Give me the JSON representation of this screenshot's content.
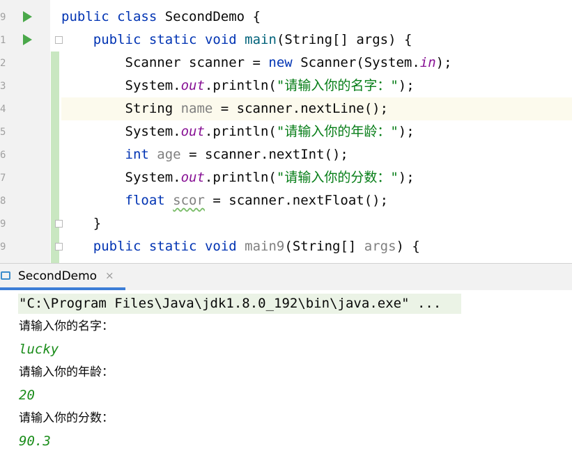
{
  "editor": {
    "line_numbers": [
      "9",
      "1",
      "2",
      "3",
      "4",
      "5",
      "6",
      "7",
      "8",
      "9",
      "9"
    ],
    "lines": [
      {
        "segs": [
          {
            "t": "public",
            "c": "kw"
          },
          {
            "t": " "
          },
          {
            "t": "class",
            "c": "kw"
          },
          {
            "t": " SecondDemo {"
          }
        ]
      },
      {
        "segs": [
          {
            "t": "    "
          },
          {
            "t": "public",
            "c": "kw"
          },
          {
            "t": " "
          },
          {
            "t": "static",
            "c": "kw"
          },
          {
            "t": " "
          },
          {
            "t": "void",
            "c": "kw"
          },
          {
            "t": " "
          },
          {
            "t": "main",
            "c": "fn"
          },
          {
            "t": "(String[] args) {"
          }
        ]
      },
      {
        "segs": [
          {
            "t": "        Scanner scanner = "
          },
          {
            "t": "new",
            "c": "kw"
          },
          {
            "t": " Scanner(System."
          },
          {
            "t": "in",
            "c": "fld"
          },
          {
            "t": ");"
          }
        ]
      },
      {
        "segs": [
          {
            "t": "        System."
          },
          {
            "t": "out",
            "c": "fld"
          },
          {
            "t": ".println("
          },
          {
            "t": "\"请输入你的名字：\"",
            "c": "str"
          },
          {
            "t": ");"
          }
        ]
      },
      {
        "segs": [
          {
            "t": "        String "
          },
          {
            "t": "name",
            "c": "unused"
          },
          {
            "t": " = scanner.nextLine();"
          }
        ]
      },
      {
        "segs": [
          {
            "t": "        System."
          },
          {
            "t": "out",
            "c": "fld"
          },
          {
            "t": ".println("
          },
          {
            "t": "\"请输入你的年龄：\"",
            "c": "str"
          },
          {
            "t": ");"
          }
        ]
      },
      {
        "segs": [
          {
            "t": "        "
          },
          {
            "t": "int",
            "c": "kw"
          },
          {
            "t": " "
          },
          {
            "t": "age",
            "c": "unused"
          },
          {
            "t": " = scanner.nextInt();"
          }
        ]
      },
      {
        "segs": [
          {
            "t": "        System."
          },
          {
            "t": "out",
            "c": "fld"
          },
          {
            "t": ".println("
          },
          {
            "t": "\"请输入你的分数：\"",
            "c": "str"
          },
          {
            "t": ");"
          }
        ]
      },
      {
        "segs": [
          {
            "t": "        "
          },
          {
            "t": "float",
            "c": "kw"
          },
          {
            "t": " "
          },
          {
            "t": "scor",
            "c": "warn"
          },
          {
            "t": " = scanner.nextFloat();"
          }
        ]
      },
      {
        "segs": [
          {
            "t": "    }"
          }
        ]
      },
      {
        "segs": [
          {
            "t": "    "
          },
          {
            "t": "public",
            "c": "kw"
          },
          {
            "t": " "
          },
          {
            "t": "static",
            "c": "kw"
          },
          {
            "t": " "
          },
          {
            "t": "void",
            "c": "kw"
          },
          {
            "t": " "
          },
          {
            "t": "main9",
            "c": "unused"
          },
          {
            "t": "(String[] "
          },
          {
            "t": "args",
            "c": "unused"
          },
          {
            "t": ") {"
          }
        ]
      }
    ]
  },
  "run_window": {
    "tab_label": "SecondDemo",
    "tab_close": "×"
  },
  "console": {
    "command": "\"C:\\Program Files\\Java\\jdk1.8.0_192\\bin\\java.exe\" ...",
    "lines": [
      {
        "text": "请输入你的名字：",
        "kind": "out"
      },
      {
        "text": "lucky",
        "kind": "in"
      },
      {
        "text": "请输入你的年龄：",
        "kind": "out"
      },
      {
        "text": "20",
        "kind": "in"
      },
      {
        "text": "请输入你的分数：",
        "kind": "out"
      },
      {
        "text": "90.3",
        "kind": "in"
      }
    ]
  },
  "colors": {
    "keyword": "#0033b3",
    "static_field": "#871094",
    "string": "#067d17",
    "user_input": "#198c19",
    "tab_underline": "#3c7dd6"
  }
}
